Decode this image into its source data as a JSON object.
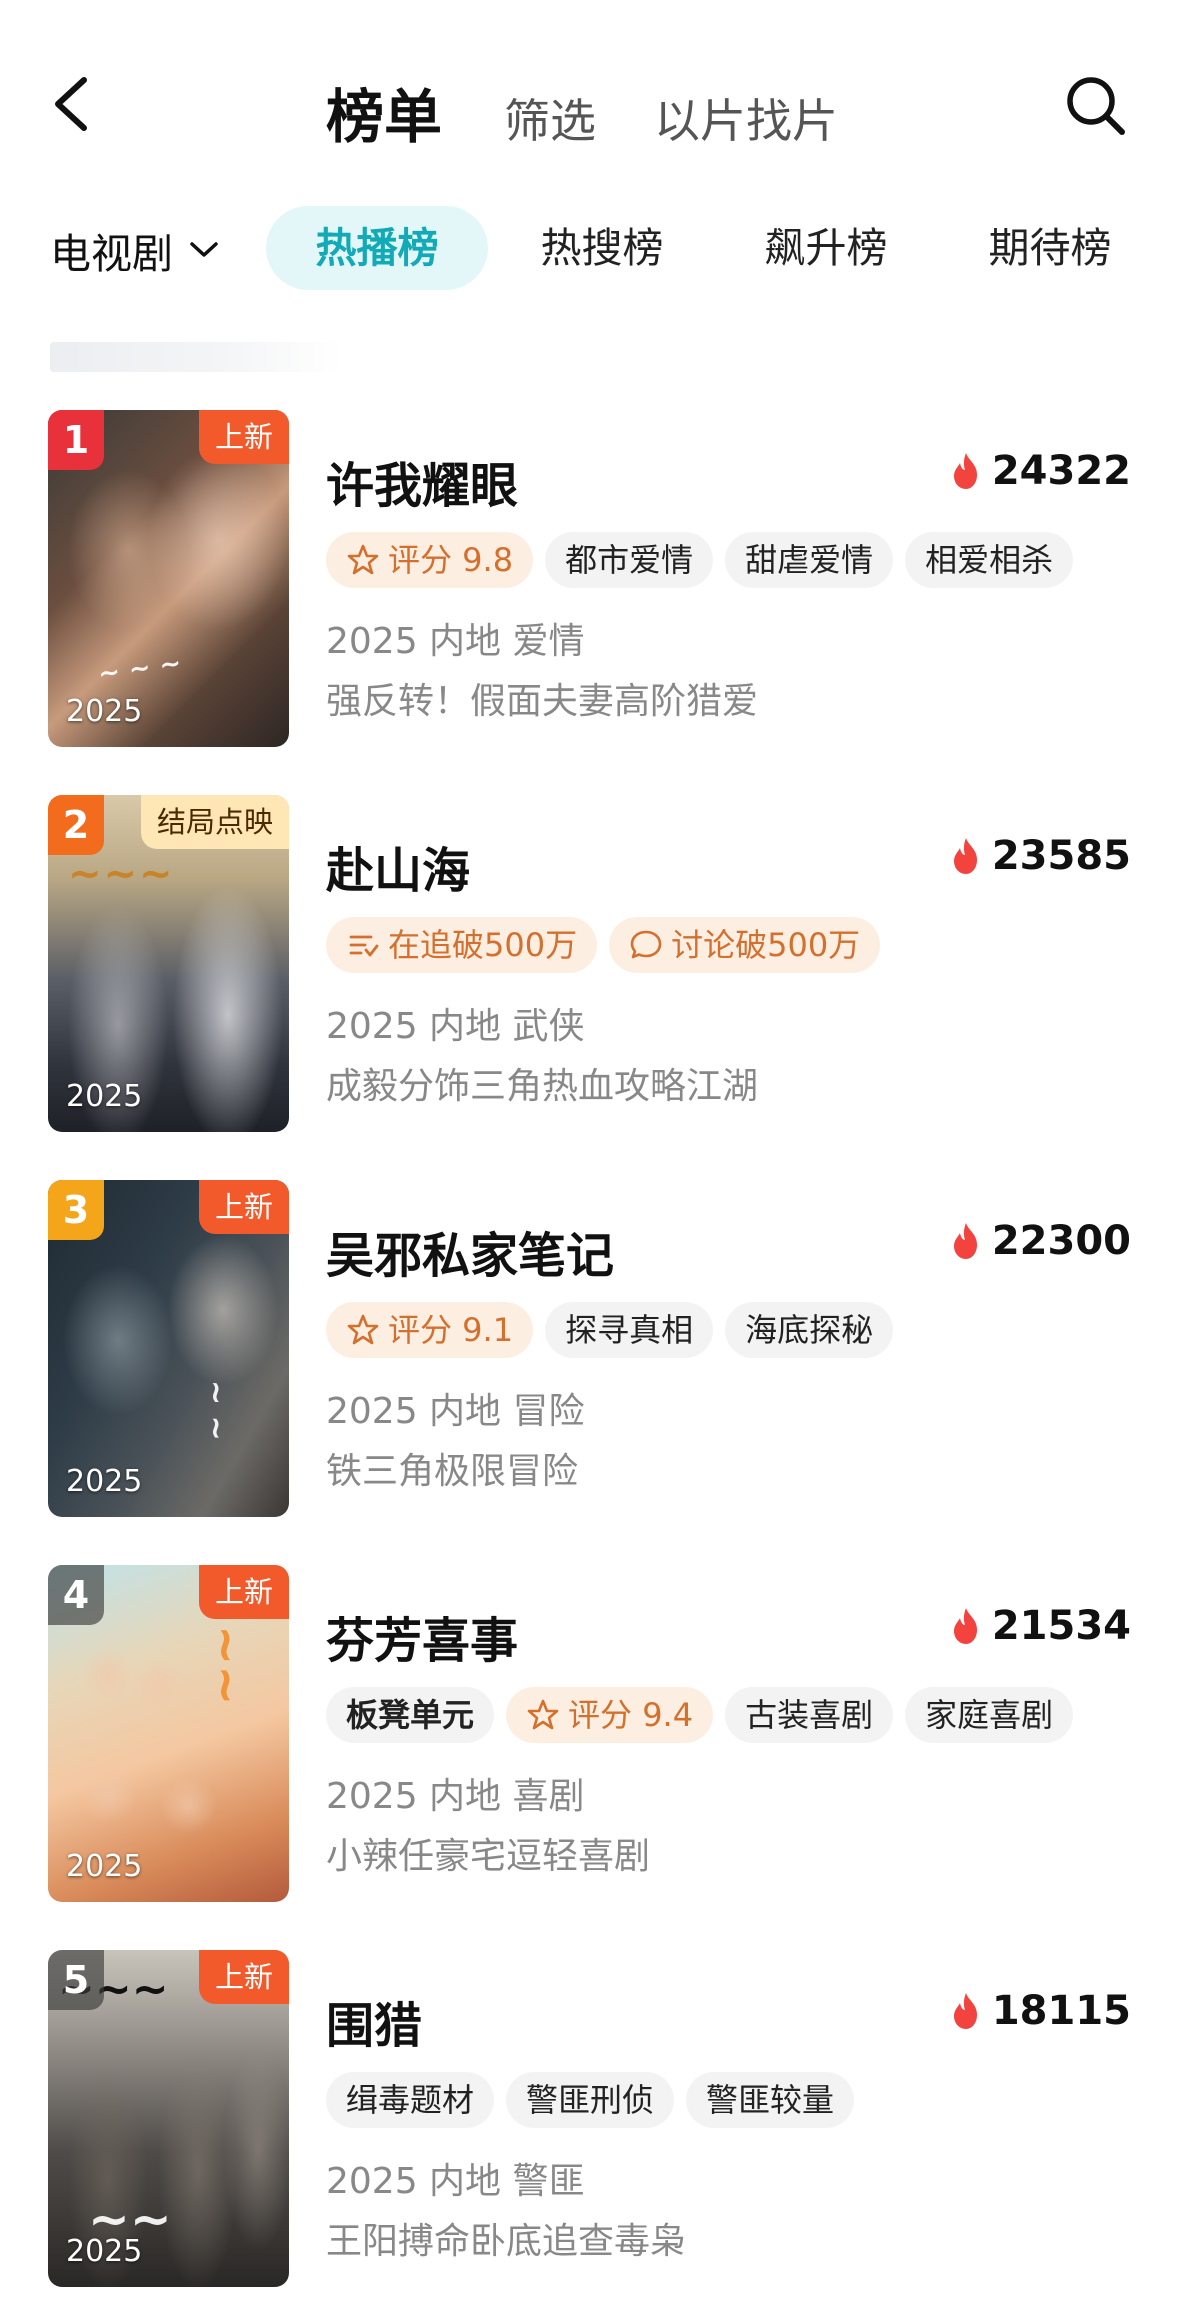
{
  "header": {
    "tabs": [
      "榜单",
      "筛选",
      "以片找片"
    ]
  },
  "filter": {
    "category": "电视剧",
    "rank_tabs": [
      "热播榜",
      "热搜榜",
      "飙升榜",
      "期待榜"
    ],
    "active_rank_tab": "热播榜"
  },
  "items": [
    {
      "rank": "1",
      "badge": "上新",
      "year": "2025",
      "title": "许我耀眼",
      "heat": "24322",
      "tags": [
        "评分 9.8",
        "都市爱情",
        "甜虐爱情",
        "相爱相杀"
      ],
      "meta": "2025 内地 爱情",
      "desc": "强反转！假面夫妻高阶猎爱"
    },
    {
      "rank": "2",
      "badge": "结局点映",
      "year": "2025",
      "title": "赴山海",
      "heat": "23585",
      "tags": [
        "在追破500万",
        "讨论破500万"
      ],
      "meta": "2025 内地 武侠",
      "desc": "成毅分饰三角热血攻略江湖"
    },
    {
      "rank": "3",
      "badge": "上新",
      "year": "2025",
      "title": "吴邪私家笔记",
      "heat": "22300",
      "tags": [
        "评分 9.1",
        "探寻真相",
        "海底探秘"
      ],
      "meta": "2025 内地 冒险",
      "desc": "铁三角极限冒险"
    },
    {
      "rank": "4",
      "badge": "上新",
      "year": "2025",
      "title": "芬芳喜事",
      "heat": "21534",
      "tags": [
        "板凳单元",
        "评分 9.4",
        "古装喜剧",
        "家庭喜剧"
      ],
      "meta": "2025 内地 喜剧",
      "desc": "小辣任豪宅逗轻喜剧"
    },
    {
      "rank": "5",
      "badge": "上新",
      "year": "2025",
      "title": "围猎",
      "heat": "18115",
      "tags": [
        "缉毒题材",
        "警匪刑侦",
        "警匪较量"
      ],
      "meta": "2025 内地 警匪",
      "desc": "王阳搏命卧底追查毒枭"
    }
  ],
  "colors": {
    "accent": "#13aab8",
    "rank1": "#e8313a",
    "rank2": "#f36b1c",
    "rank3": "#f4a51a",
    "rank_other": "#4a4a4a",
    "badge_new": "#f25a2b",
    "tag_orange": "#d4702e"
  },
  "icons": [
    "back-arrow-icon",
    "search-icon",
    "chevron-down-icon",
    "flame-icon",
    "star-icon",
    "list-icon",
    "comment-icon"
  ]
}
